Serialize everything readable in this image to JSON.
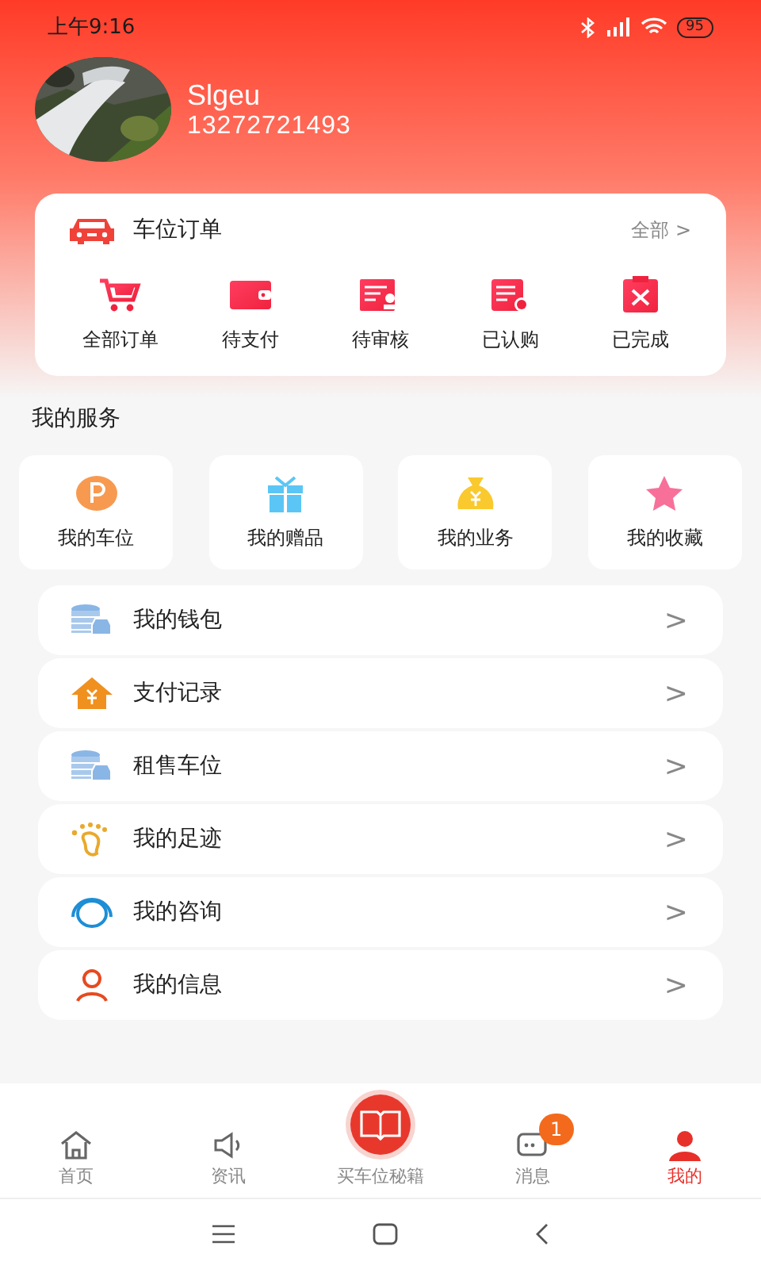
{
  "status_bar": {
    "time": "上午9:16",
    "battery": "95"
  },
  "profile": {
    "name": "Slgeu",
    "phone": "13272721493"
  },
  "orders": {
    "title": "车位订单",
    "more": "全部",
    "more_arrow": ">",
    "items": [
      {
        "label": "全部订单",
        "kind": "cart"
      },
      {
        "label": "待支付",
        "kind": "wallet"
      },
      {
        "label": "待审核",
        "kind": "review"
      },
      {
        "label": "已认购",
        "kind": "bought"
      },
      {
        "label": "已完成",
        "kind": "done"
      }
    ]
  },
  "services": {
    "title": "我的服务",
    "items": [
      {
        "label": "我的车位",
        "kind": "parking"
      },
      {
        "label": "我的赠品",
        "kind": "gift"
      },
      {
        "label": "我的业务",
        "kind": "money"
      },
      {
        "label": "我的收藏",
        "kind": "star"
      }
    ]
  },
  "menu": [
    {
      "label": "我的钱包",
      "kind": "coins",
      "arrow": ">"
    },
    {
      "label": "支付记录",
      "kind": "house",
      "arrow": ">"
    },
    {
      "label": "租售车位",
      "kind": "coins",
      "arrow": ">"
    },
    {
      "label": "我的足迹",
      "kind": "foot",
      "arrow": ">"
    },
    {
      "label": "我的咨询",
      "kind": "headset",
      "arrow": ">"
    },
    {
      "label": "我的信息",
      "kind": "person",
      "arrow": ">"
    }
  ],
  "tabs": [
    {
      "label": "首页",
      "kind": "home",
      "selected": false
    },
    {
      "label": "资讯",
      "kind": "speaker",
      "selected": false
    },
    {
      "label": "买车位秘籍",
      "kind": "book",
      "selected": false
    },
    {
      "label": "消息",
      "kind": "chat",
      "selected": false,
      "badge": "1"
    },
    {
      "label": "我的",
      "kind": "person",
      "selected": true
    }
  ]
}
